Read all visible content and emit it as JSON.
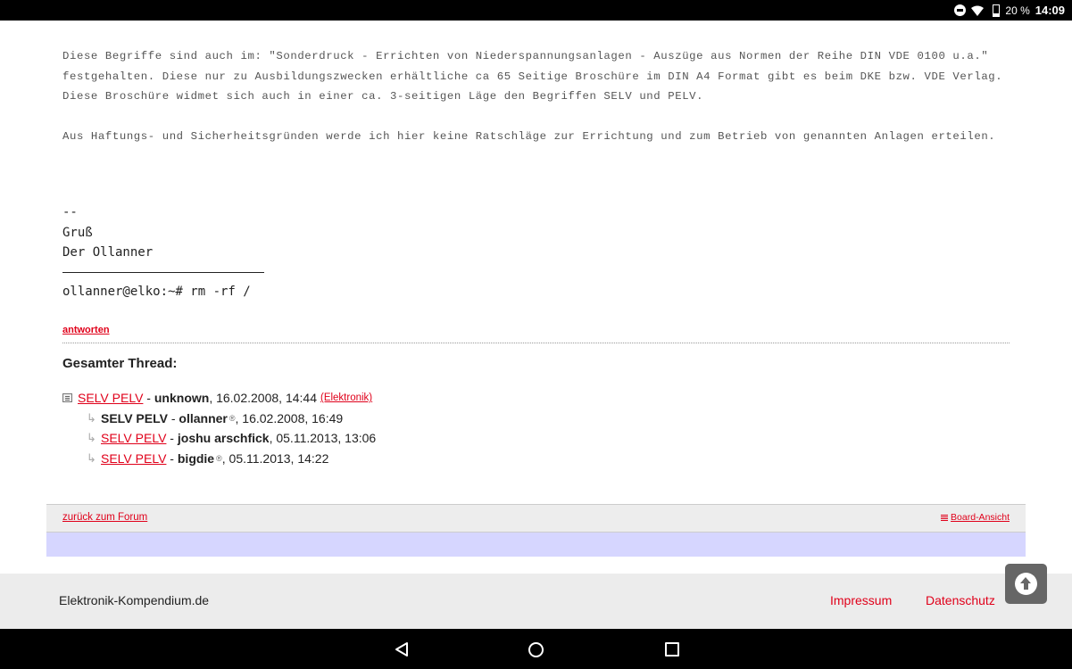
{
  "status_bar": {
    "battery_pct": "20 %",
    "time": "14:09",
    "icons": [
      "dnd-icon",
      "wifi-icon",
      "battery-icon"
    ]
  },
  "post": {
    "paragraphs": [
      "Diese Begriffe sind auch im: \"Sonderdruck - Errichten von Niederspannungsanlagen - Auszüge aus Normen der Reihe DIN VDE 0100 u.a.\" festgehalten. Diese nur zu Ausbildungszwecken erhältliche ca 65 Seitige Broschüre im DIN A4 Format gibt es beim DKE bzw. VDE Verlag. Diese Broschüre widmet sich auch in einer ca. 3-seitigen Läge den Begriffen SELV und PELV.",
      "Aus Haftungs- und Sicherheitsgründen werde ich hier keine Ratschläge zur Errichtung und zum Betrieb von genannten Anlagen erteilen."
    ],
    "signature": {
      "dashes": "--",
      "greeting": "Gruß",
      "name": "Der Ollanner",
      "prompt": "ollanner@elko:~# rm -rf /"
    },
    "reply_label": "antworten"
  },
  "thread": {
    "heading": "Gesamter Thread:",
    "root": {
      "subject": "SELV PELV",
      "author": "unknown",
      "date": "16.02.2008, 14:44",
      "category": "(Elektronik)"
    },
    "replies": [
      {
        "subject": "SELV PELV",
        "author": "ollanner",
        "registered": true,
        "date": "16.02.2008, 16:49",
        "current": true
      },
      {
        "subject": "SELV PELV",
        "author": "joshu arschfick",
        "registered": false,
        "date": "05.11.2013, 13:06",
        "current": false
      },
      {
        "subject": "SELV PELV",
        "author": "bigdie",
        "registered": true,
        "date": "05.11.2013, 14:22",
        "current": false
      }
    ],
    "reg_symbol": "®"
  },
  "board_nav": {
    "back_label": "zurück zum Forum",
    "board_view_label": "Board-Ansicht"
  },
  "footer": {
    "site_name": "Elektronik-Kompendium.de",
    "impressum": "Impressum",
    "datenschutz": "Datenschutz"
  },
  "colors": {
    "link_red": "#e0001a",
    "band_lavender": "#d6d6ff",
    "footer_gray": "#ececec"
  }
}
